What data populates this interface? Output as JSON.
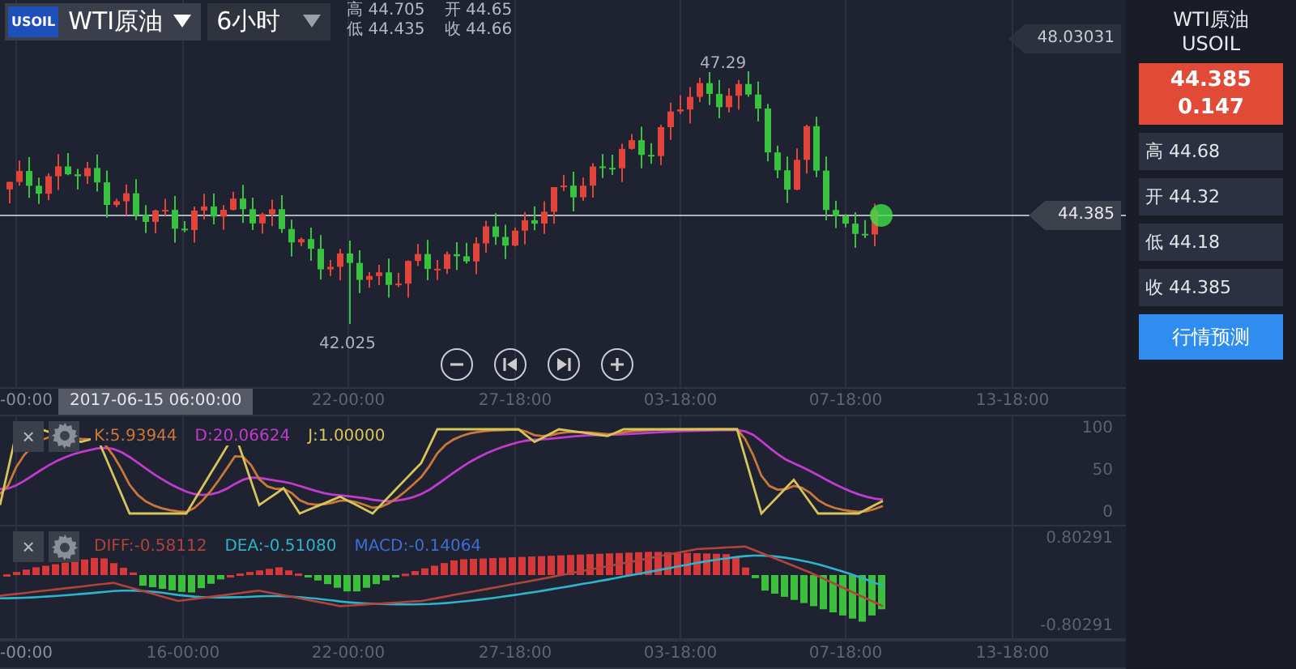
{
  "header": {
    "logo": "USOIL",
    "symbol": "WTI原油",
    "period": "6小时",
    "stats": [
      {
        "label": "高",
        "value": "44.705"
      },
      {
        "label": "开",
        "value": "44.65"
      },
      {
        "label": "低",
        "value": "44.435"
      },
      {
        "label": "收",
        "value": "44.66"
      }
    ]
  },
  "main_chart": {
    "price_tags": [
      {
        "kind": "upper",
        "text": "48.03031"
      },
      {
        "kind": "current",
        "text": "44.385"
      }
    ],
    "annotations": [
      {
        "kind": "high",
        "text": "47.29"
      },
      {
        "kind": "low",
        "text": "42.025"
      }
    ],
    "controls": [
      {
        "kind": "zoom-out"
      },
      {
        "kind": "previous"
      },
      {
        "kind": "next"
      },
      {
        "kind": "zoom-in"
      }
    ]
  },
  "time_axis": {
    "cursor_label": "2017-06-15 06:00:00",
    "labels": [
      "-00:00",
      "22-00:00",
      "27-18:00",
      "03-18:00",
      "07-18:00",
      "13-18:00"
    ]
  },
  "kdj": {
    "close": "×",
    "legend": [
      {
        "text": "K:5.93944",
        "color": "#c9783a"
      },
      {
        "text": "D:20.06624",
        "color": "#c13bcf"
      },
      {
        "text": "J:1.00000",
        "color": "#d6c55a"
      }
    ],
    "y_labels": [
      "100",
      "50",
      "0"
    ]
  },
  "macd": {
    "close": "×",
    "legend": [
      {
        "text": "DIFF:-0.58112",
        "color": "#b0443c"
      },
      {
        "text": "DEA:-0.51080",
        "color": "#2fb3c8"
      },
      {
        "text": "MACD:-0.14064",
        "color": "#3b6fd6"
      }
    ],
    "y_labels": [
      "0.80291",
      "-0.80291"
    ]
  },
  "bottom_axis": {
    "labels": [
      "-00:00",
      "16-00:00",
      "22-00:00",
      "27-18:00",
      "03-18:00",
      "07-18:00",
      "13-18:00"
    ]
  },
  "side_panel": {
    "name": "WTI原油",
    "code": "USOIL",
    "price": "44.385",
    "change": "0.147",
    "stats": [
      {
        "label": "高",
        "value": "44.68"
      },
      {
        "label": "开",
        "value": "44.32"
      },
      {
        "label": "低",
        "value": "44.18"
      },
      {
        "label": "收",
        "value": "44.385"
      }
    ],
    "button": "行情预测"
  }
}
